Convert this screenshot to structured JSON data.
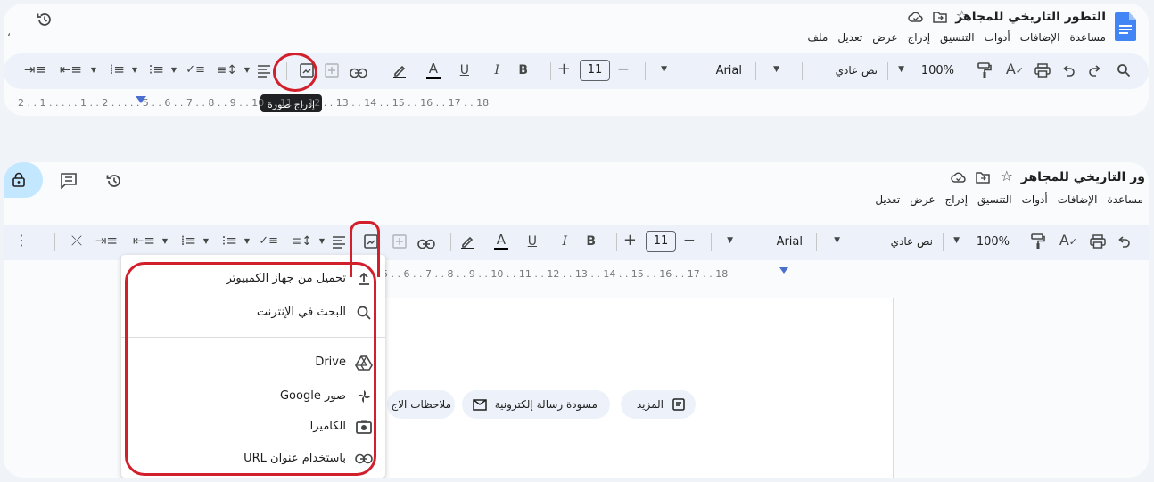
{
  "doc_title": "التطور التاريخي للمجاهر",
  "doc_title_truncated": "ور التاريخي للمجاهر",
  "menu": [
    "ملف",
    "تعديل",
    "عرض",
    "إدراج",
    "التنسيق",
    "أدوات",
    "الإضافات",
    "مساعدة"
  ],
  "menu_truncated": [
    "تعديل",
    "عرض",
    "إدراج",
    "التنسيق",
    "أدوات",
    "الإضافات",
    "مساعدة"
  ],
  "toolbar": {
    "zoom": "100%",
    "style": "نص عادي",
    "font": "Arial",
    "font_size": "11",
    "minus": "−",
    "plus": "+",
    "bold": "B",
    "italic": "I",
    "underline": "U",
    "text_color": "A"
  },
  "tooltip": "إدراج صورة",
  "ruler_p1": "2 . . 1 . .   . . . 1 . . 2 . .   . . . 5 . . 6 . . 7 . . 8 . . 9 . . 10 . . 11 . . 12 . . 13 . . 14 . . 15 . . 16 . . 17 . . 18",
  "ruler_p2": "5 . . 6 . . 7 . . 8 . . 9 . . 10 . . 11 . . 12 . . 13 . . 14 . . 15 . . 16 . . 17 . . 18",
  "image_menu": [
    {
      "label": "تحميل من جهاز الكمبيوتر",
      "icon": "upload-icon"
    },
    {
      "label": "البحث في الإنترنت",
      "icon": "search-icon"
    },
    {
      "label": "Drive",
      "icon": "drive-icon"
    },
    {
      "label": "صور Google",
      "icon": "google-photos-icon"
    },
    {
      "label": "الكاميرا",
      "icon": "camera-icon"
    },
    {
      "label": "باستخدام عنوان URL",
      "icon": "link-icon"
    }
  ],
  "chips": [
    "المزيد",
    "مسودة رسالة إلكترونية",
    "ملاحظات الاج"
  ],
  "colors": {
    "accent_red": "#d21f2c",
    "toolbar_bg": "#edf2fa",
    "docs_blue": "#4285f4"
  }
}
